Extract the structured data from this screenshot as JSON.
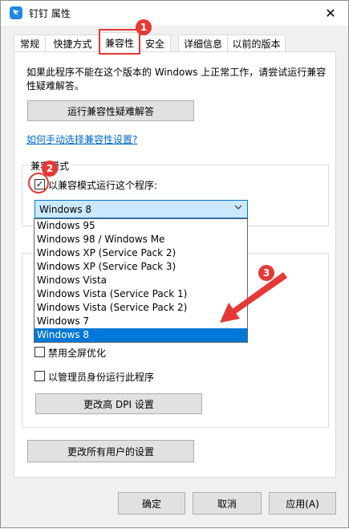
{
  "window": {
    "title": "钉钉 属性",
    "close_glyph": "✕"
  },
  "tabs": [
    {
      "label": "常规"
    },
    {
      "label": "快捷方式"
    },
    {
      "label": "兼容性"
    },
    {
      "label": "安全"
    },
    {
      "label": "详细信息"
    },
    {
      "label": "以前的版本"
    }
  ],
  "compat": {
    "description": "如果此程序不能在这个版本的 Windows 上正常工作，请尝试运行兼容性疑难解答。",
    "troubleshoot_button": "运行兼容性疑难解答",
    "manual_link": "如何手动选择兼容性设置?",
    "mode_group_title": "兼容模式",
    "run_compat_label": "以兼容模式运行这个程序:",
    "run_compat_checked": "✓",
    "selected_os": "Windows 8",
    "os_options": [
      "Windows 95",
      "Windows 98 / Windows Me",
      "Windows XP (Service Pack 2)",
      "Windows XP (Service Pack 3)",
      "Windows Vista",
      "Windows Vista (Service Pack 1)",
      "Windows Vista (Service Pack 2)",
      "Windows 7",
      "Windows 8"
    ],
    "disable_fullscreen_label": "禁用全屏优化",
    "run_as_admin_label": "以管理员身份运行此程序",
    "high_dpi_button": "更改高 DPI 设置",
    "all_users_button": "更改所有用户的设置"
  },
  "footer": {
    "ok": "确定",
    "cancel": "取消",
    "apply": "应用(A)"
  },
  "annotations": {
    "badge1": "1",
    "badge2": "2",
    "badge3": "3",
    "color": "#e53935"
  },
  "colors": {
    "link": "#0066cc",
    "select_bg": "#cce8ff",
    "accent": "#0078d7"
  }
}
